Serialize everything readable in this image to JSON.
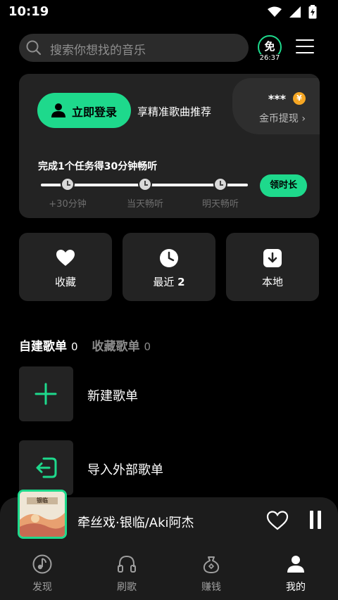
{
  "status": {
    "time": "10:19",
    "icons": [
      "wifi-icon",
      "signal-icon",
      "battery-charging-icon"
    ]
  },
  "search": {
    "placeholder": "搜索你想找的音乐",
    "icon": "search-icon"
  },
  "free_badge": {
    "label": "免",
    "timer": "26:37"
  },
  "menu": {
    "icon": "hamburger-menu-icon"
  },
  "login_card": {
    "login_button": "立即登录",
    "login_tip": "享精准歌曲推荐",
    "coins_masked": "***",
    "coin_symbol": "¥",
    "coin_withdraw": "金币提现 ›",
    "task_title": "完成1个任务得30分钟畅听",
    "task_steps": [
      "+30分钟",
      "当天畅听",
      "明天畅听"
    ],
    "task_button": "领时长"
  },
  "quick_actions": [
    {
      "label": "收藏",
      "icon": "heart-icon"
    },
    {
      "label": "最近",
      "count": "2",
      "icon": "clock-icon"
    },
    {
      "label": "本地",
      "icon": "download-icon"
    }
  ],
  "playlist_tabs": [
    {
      "label": "自建歌单",
      "count": "0",
      "active": true
    },
    {
      "label": "收藏歌单",
      "count": "0",
      "active": false
    }
  ],
  "playlist_actions": [
    {
      "label": "新建歌单",
      "icon": "plus-icon"
    },
    {
      "label": "导入外部歌单",
      "icon": "import-icon"
    }
  ],
  "player": {
    "song": "牵丝戏·银临/Aki阿杰",
    "cover_text": "银临"
  },
  "nav": [
    {
      "label": "发现",
      "icon": "discover-icon",
      "active": false
    },
    {
      "label": "刷歌",
      "icon": "headphones-icon",
      "active": false
    },
    {
      "label": "赚钱",
      "icon": "money-bag-icon",
      "active": false
    },
    {
      "label": "我的",
      "icon": "profile-icon",
      "active": true
    }
  ],
  "colors": {
    "accent": "#1ed98c",
    "background": "#000000",
    "card": "#232323",
    "coin": "#f5a623"
  }
}
